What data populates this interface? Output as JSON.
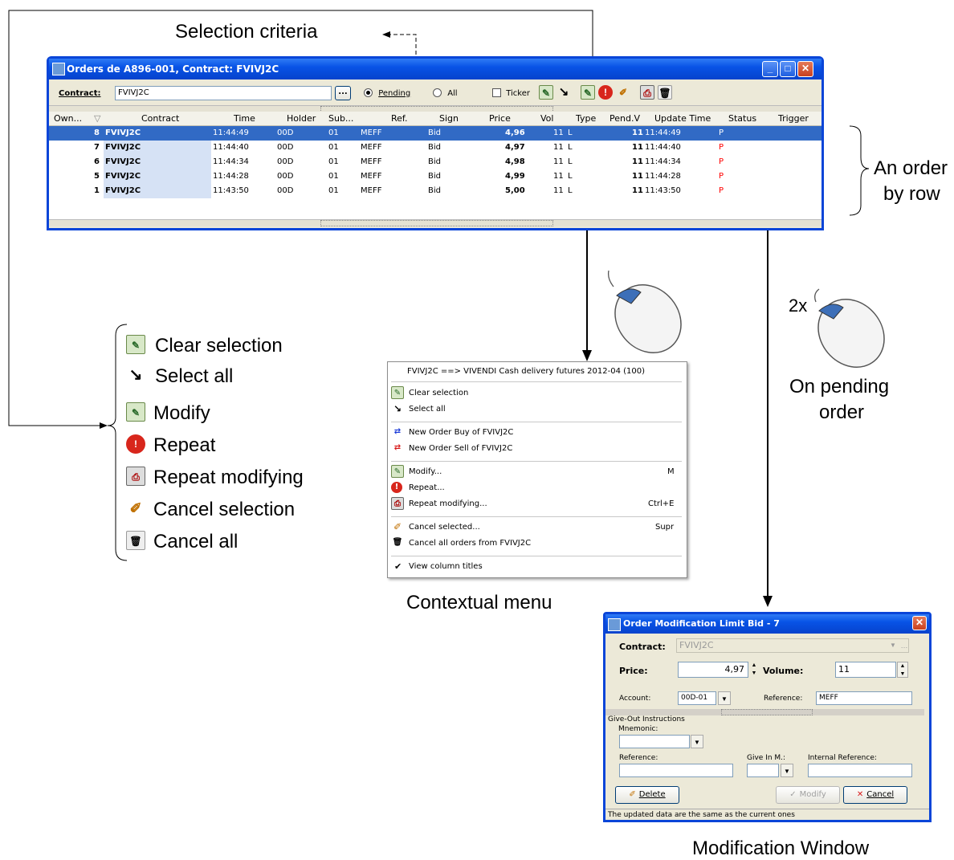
{
  "annotations": {
    "selection_criteria": "Selection criteria",
    "order_by_row_line1": "An order",
    "order_by_row_line2": "by row",
    "double_click": "2x",
    "on_pending_line1": "On pending",
    "on_pending_line2": "order",
    "contextual_menu": "Contextual menu",
    "modification_window": "Modification Window"
  },
  "legend": [
    {
      "label": "Clear selection",
      "icon": "clear-selection-icon"
    },
    {
      "label": "Select all",
      "icon": "select-all-icon"
    },
    {
      "label": "Modify",
      "icon": "modify-icon"
    },
    {
      "label": "Repeat",
      "icon": "repeat-icon"
    },
    {
      "label": "Repeat modifying",
      "icon": "repeat-modifying-icon"
    },
    {
      "label": "Cancel selection",
      "icon": "cancel-selection-icon"
    },
    {
      "label": "Cancel all",
      "icon": "cancel-all-icon"
    }
  ],
  "orders_window": {
    "title": "Orders de A896-001, Contract: FVIVJ2C",
    "contract_label": "Contract:",
    "contract_value": "FVIVJ2C",
    "browse_label": "...",
    "pending_label": "Pending",
    "all_label": "All",
    "ticker_label": "Ticker",
    "columns": [
      "Own...",
      "Contract",
      "Time",
      "Holder",
      "Sub...",
      "Ref.",
      "Sign",
      "Price",
      "Vol",
      "Type",
      "Pend.V",
      "Update Time",
      "Status",
      "Trigger"
    ],
    "rows": [
      {
        "own": "8",
        "contract": "FVIVJ2C",
        "time": "11:44:49",
        "holder": "00D",
        "sub": "01",
        "ref": "MEFF",
        "sign": "Bid",
        "price": "4,96",
        "vol": "11",
        "type": "L",
        "pendv": "11",
        "update": "11:44:49",
        "status": "P"
      },
      {
        "own": "7",
        "contract": "FVIVJ2C",
        "time": "11:44:40",
        "holder": "00D",
        "sub": "01",
        "ref": "MEFF",
        "sign": "Bid",
        "price": "4,97",
        "vol": "11",
        "type": "L",
        "pendv": "11",
        "update": "11:44:40",
        "status": "P"
      },
      {
        "own": "6",
        "contract": "FVIVJ2C",
        "time": "11:44:34",
        "holder": "00D",
        "sub": "01",
        "ref": "MEFF",
        "sign": "Bid",
        "price": "4,98",
        "vol": "11",
        "type": "L",
        "pendv": "11",
        "update": "11:44:34",
        "status": "P"
      },
      {
        "own": "5",
        "contract": "FVIVJ2C",
        "time": "11:44:28",
        "holder": "00D",
        "sub": "01",
        "ref": "MEFF",
        "sign": "Bid",
        "price": "4,99",
        "vol": "11",
        "type": "L",
        "pendv": "11",
        "update": "11:44:28",
        "status": "P"
      },
      {
        "own": "1",
        "contract": "FVIVJ2C",
        "time": "11:43:50",
        "holder": "00D",
        "sub": "01",
        "ref": "MEFF",
        "sign": "Bid",
        "price": "5,00",
        "vol": "11",
        "type": "L",
        "pendv": "11",
        "update": "11:43:50",
        "status": "P"
      }
    ]
  },
  "context_menu": {
    "header": "FVIVJ2C ==> VIVENDI Cash delivery futures  2012-04  (100)",
    "items": [
      {
        "label": "Clear selection",
        "shortcut": ""
      },
      {
        "label": "Select all",
        "shortcut": ""
      },
      {
        "label": "New Order Buy of FVIVJ2C",
        "shortcut": ""
      },
      {
        "label": "New Order Sell of FVIVJ2C",
        "shortcut": ""
      },
      {
        "label": "Modify...",
        "shortcut": "M"
      },
      {
        "label": "Repeat...",
        "shortcut": ""
      },
      {
        "label": "Repeat modifying...",
        "shortcut": "Ctrl+E"
      },
      {
        "label": "Cancel selected...",
        "shortcut": "Supr"
      },
      {
        "label": "Cancel all orders from FVIVJ2C",
        "shortcut": ""
      },
      {
        "label": "View column titles",
        "shortcut": ""
      }
    ]
  },
  "modification_window": {
    "title": "Order Modification Limit Bid - 7",
    "contract_label": "Contract:",
    "contract_value": "FVIVJ2C",
    "price_label": "Price:",
    "price_value": "4,97",
    "volume_label": "Volume:",
    "volume_value": "11",
    "account_label": "Account:",
    "account_value": "00D-01",
    "reference_label": "Reference:",
    "reference_value": "MEFF",
    "give_out_label": "Give-Out Instructions",
    "mnemonic_label": "Mnemonic:",
    "reference2_label": "Reference:",
    "give_in_label": "Give In M.:",
    "internal_ref_label": "Internal Reference:",
    "delete_label": "Delete",
    "modify_label": "Modify",
    "cancel_label": "Cancel",
    "status_text": "The updated data are the same as the current ones"
  },
  "colors": {
    "selection": "#316ac5",
    "title_bar": "#0853e6",
    "status_p": "#ff0000",
    "contract_col": "#d6e2f5"
  }
}
